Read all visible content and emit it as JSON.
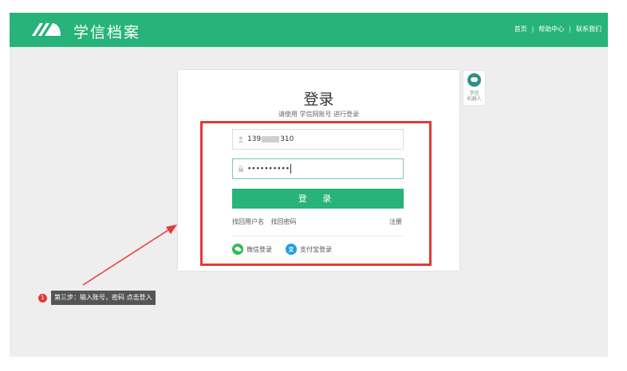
{
  "header": {
    "brand": "学信档案",
    "nav": {
      "home": "首页",
      "help": "帮助中心",
      "contact": "联系我们",
      "separator": "|"
    }
  },
  "login": {
    "title": "登录",
    "subtitle": "请使用 学信网账号 进行登录",
    "username_value": "139",
    "username_suffix": "310",
    "password_value": "••••••••••",
    "submit_label": "登 录",
    "forgot_username": "找回用户名",
    "forgot_password": "找回密码",
    "register": "注册",
    "wechat_label": "微信登录",
    "alipay_label": "支付宝登录"
  },
  "robot": {
    "line1": "学信",
    "line2": "机器人"
  },
  "annotation": {
    "step_number": "1",
    "step_text": "第三步：输入账号，密码 点击登入"
  },
  "colors": {
    "brand": "#27b37a",
    "highlight": "#e53935",
    "tooltip": "#555555"
  }
}
